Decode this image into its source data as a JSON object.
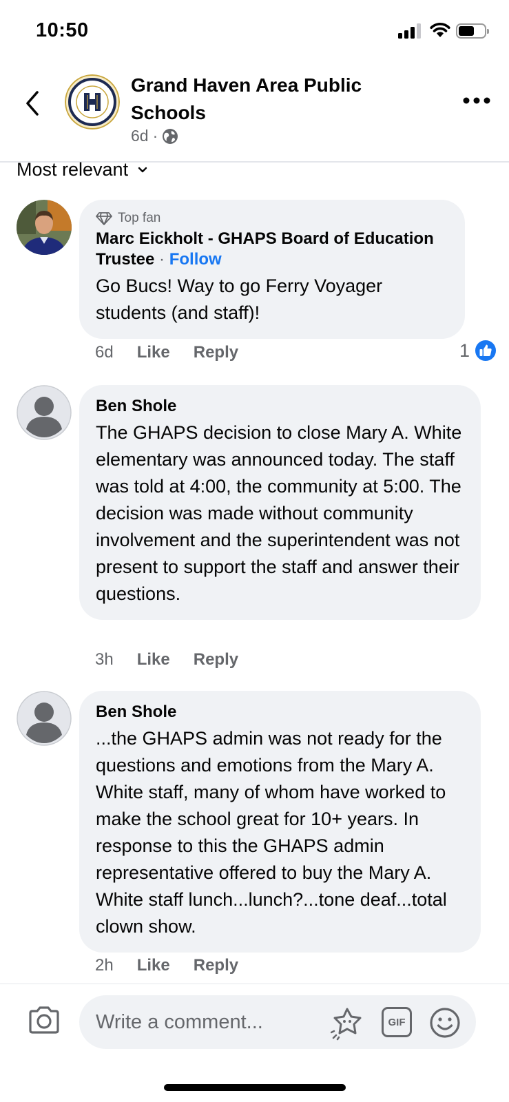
{
  "status_bar": {
    "time": "10:50"
  },
  "post_header": {
    "page_name": "Grand Haven Area Public Schools",
    "time_ago": "6d",
    "separator": "·",
    "audience_icon": "globe-icon"
  },
  "sort": {
    "label": "Most relevant",
    "icon": "chevron-down-icon"
  },
  "comments": [
    {
      "badge": "Top fan",
      "badge_icon": "diamond-icon",
      "author": "Marc Eickholt - GHAPS Board of Education Trustee",
      "separator": "·",
      "follow_label": "Follow",
      "text": "Go Bucs! Way to go Ferry Voyager students (and staff)!",
      "time": "6d",
      "like_label": "Like",
      "reply_label": "Reply",
      "reaction_count": "1",
      "reaction_icon": "like-reaction-icon"
    },
    {
      "author": "Ben Shole",
      "text": "The GHAPS decision to close Mary A. White elementary was announced today. The staff was told at 4:00, the community at 5:00. The decision was made without community involvement and the superintendent was not present to support the staff and answer their questions.",
      "time": "3h",
      "like_label": "Like",
      "reply_label": "Reply"
    },
    {
      "author": "Ben Shole",
      "text": "...the GHAPS admin was not ready for the questions and emotions from the Mary A. White staff, many of whom have worked to make the school great for 10+ years. In response to this the GHAPS admin representative offered to buy the Mary A. White staff lunch...lunch?...tone deaf...total clown show.",
      "time": "2h",
      "like_label": "Like",
      "reply_label": "Reply"
    }
  ],
  "composer": {
    "placeholder": "Write a comment...",
    "gif_label": "GIF"
  },
  "colors": {
    "accent": "#1877f2",
    "bubble": "#f0f2f5",
    "secondary_text": "#65676b"
  }
}
